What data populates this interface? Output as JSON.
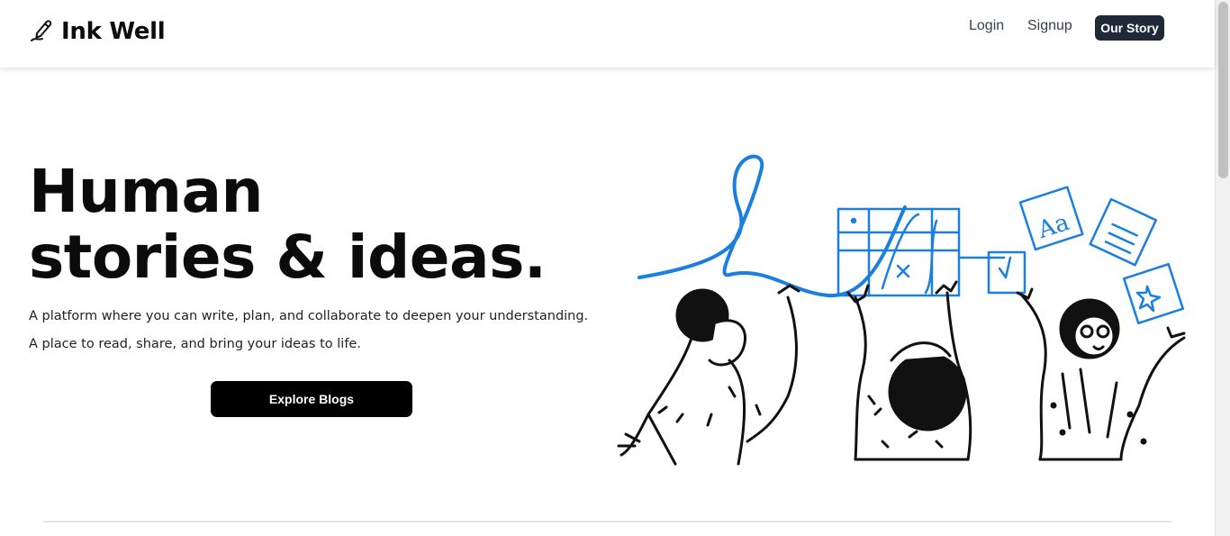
{
  "brand": {
    "name": "Ink Well",
    "icon": "pen-writing-icon"
  },
  "nav": {
    "login": "Login",
    "signup": "Signup",
    "our_story": "Our Story"
  },
  "hero": {
    "title_line1": "Human",
    "title_line2": "stories & ideas.",
    "description": "A platform where you can write, plan, and collaborate to deepen your understanding. A place to read, share, and bring your ideas to life.",
    "cta": "Explore Blogs"
  },
  "colors": {
    "accent": "#1a7fe0",
    "dark_button": "#1f2937",
    "cta": "#000000"
  }
}
